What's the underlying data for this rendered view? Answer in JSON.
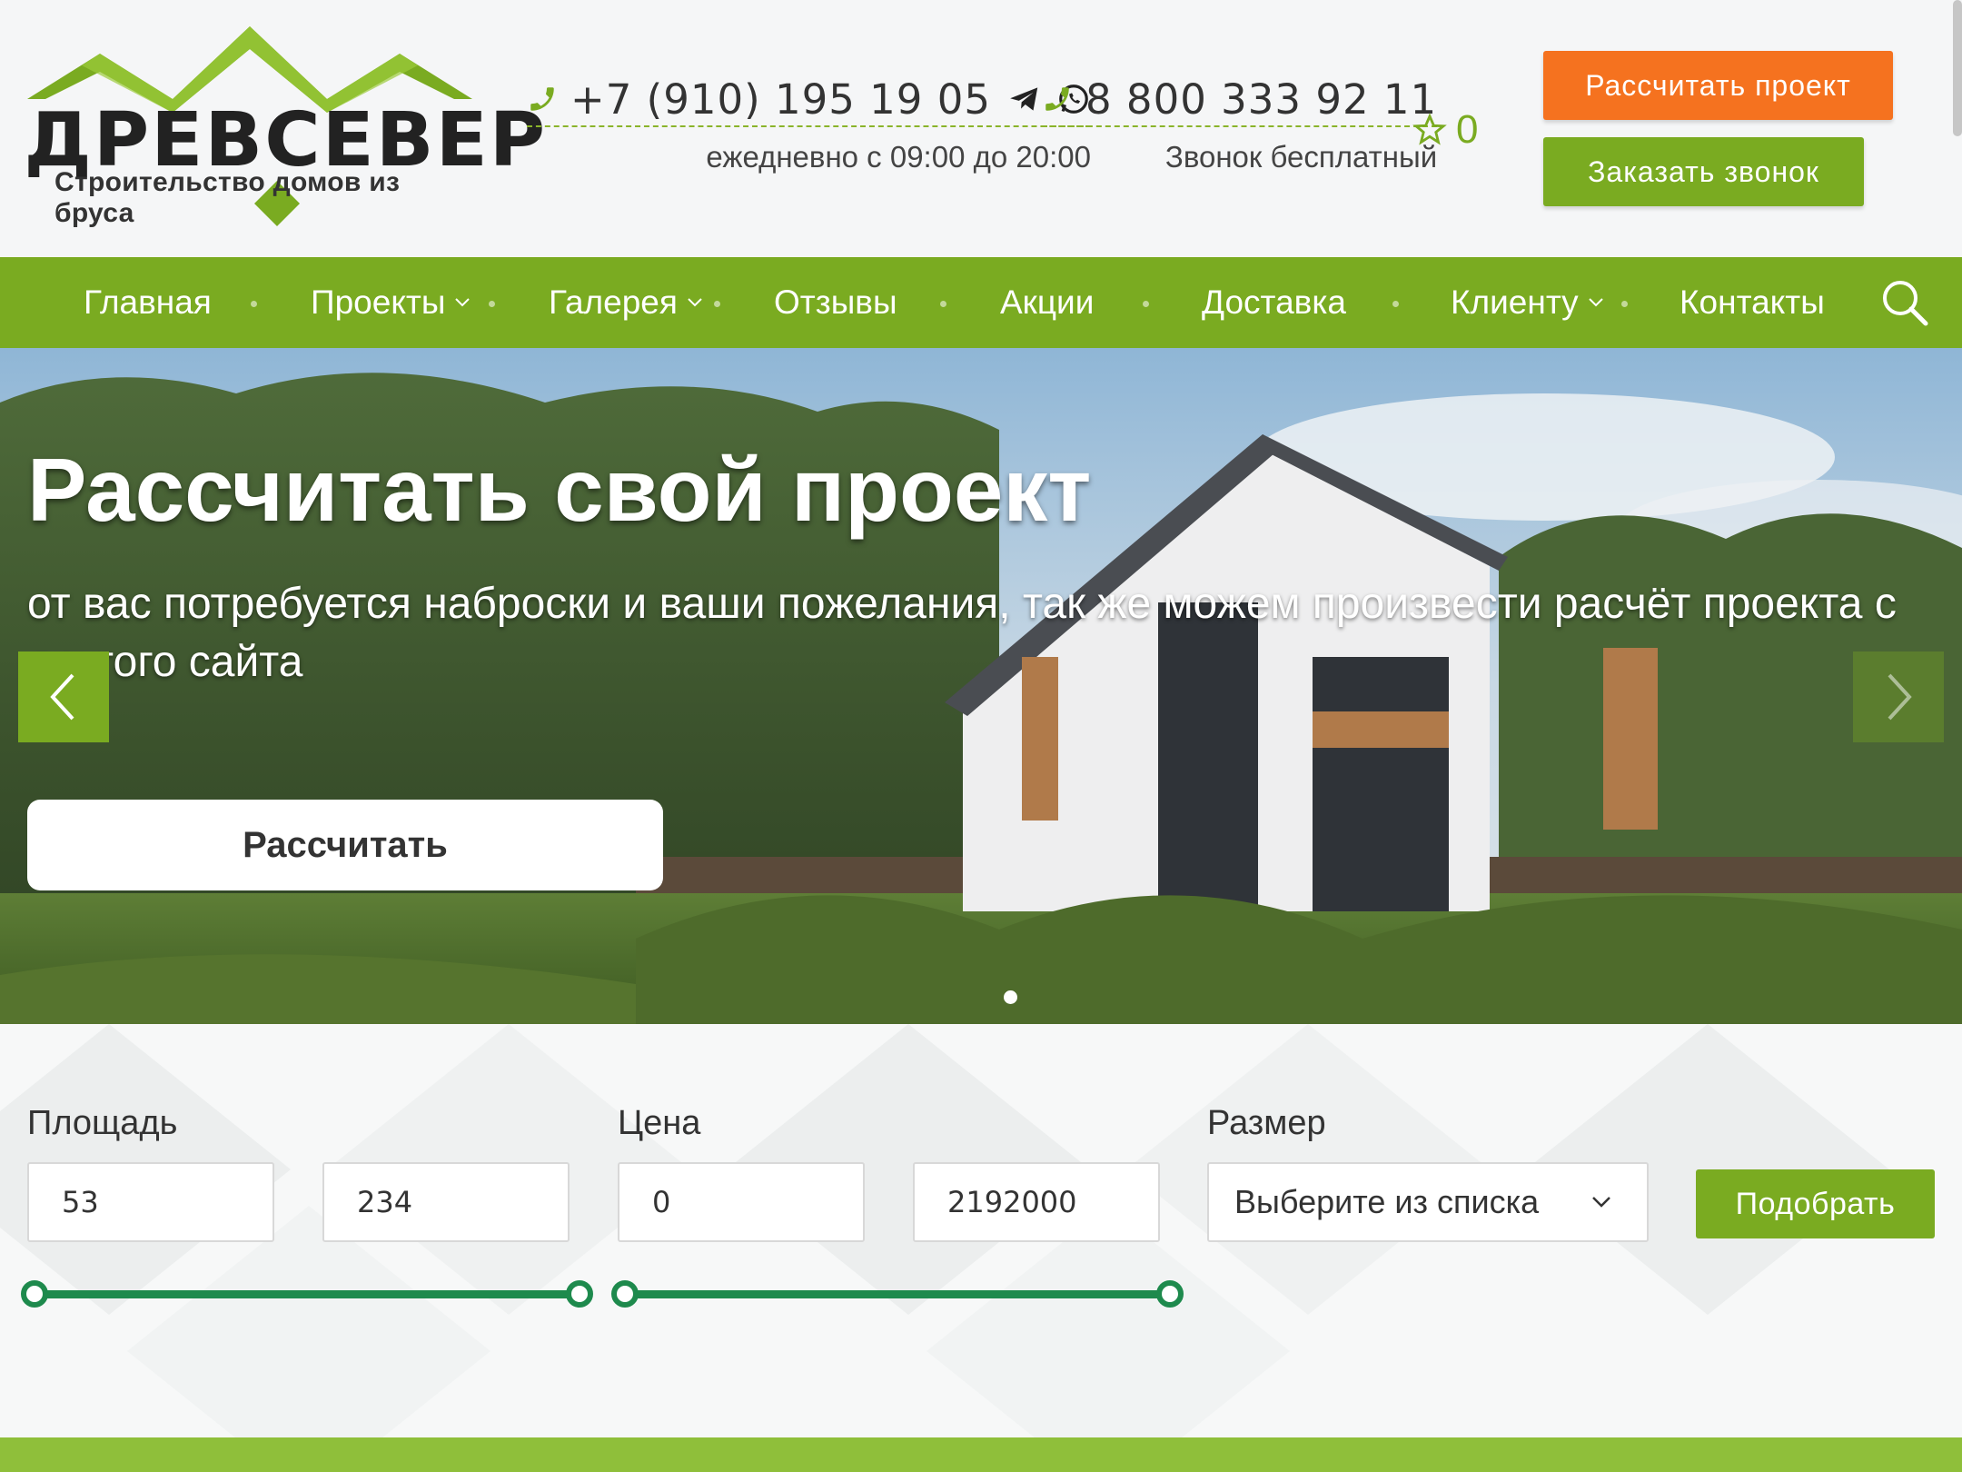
{
  "brand": {
    "name": "ДРЕВСЕВЕР",
    "tagline": "Строительство домов из бруса",
    "colors": {
      "green": "#7aab21",
      "orange": "#f5721f",
      "slider": "#1e8a4d"
    }
  },
  "header": {
    "phone1": {
      "number": "+7 (910) 195 19 05",
      "note": "ежедневно с 09:00 до 20:00",
      "icons": [
        "phone-icon",
        "telegram-icon",
        "whatsapp-icon"
      ]
    },
    "phone2": {
      "number": "8 800 333 92 11",
      "note": "Звонок бесплатный",
      "icons": [
        "phone-icon"
      ]
    },
    "favorites": {
      "icon": "star-icon",
      "count": "0"
    },
    "calc_button": "Рассчитать проект",
    "callback_button": "Заказать звонок"
  },
  "nav": {
    "items": [
      {
        "label": "Главная",
        "dropdown": false
      },
      {
        "label": "Проекты",
        "dropdown": true
      },
      {
        "label": "Галерея",
        "dropdown": true
      },
      {
        "label": "Отзывы",
        "dropdown": false
      },
      {
        "label": "Акции",
        "dropdown": false
      },
      {
        "label": "Доставка",
        "dropdown": false
      },
      {
        "label": "Клиенту",
        "dropdown": true
      },
      {
        "label": "Контакты",
        "dropdown": false
      }
    ],
    "search_icon": "search-icon"
  },
  "hero": {
    "title": "Рассчитать свой проект",
    "subtitle": "от вас потребуется наброски и ваши пожелания, так же можем произвести расчёт проекта с другого сайта",
    "button": "Рассчитать",
    "slides_count": 1,
    "active_slide": 1
  },
  "filter": {
    "area": {
      "label": "Площадь",
      "min": "53",
      "max": "234"
    },
    "price": {
      "label": "Цена",
      "min": "0",
      "max": "2192000"
    },
    "size": {
      "label": "Размер",
      "selected": "Выберите из списка"
    },
    "submit": "Подобрать"
  }
}
